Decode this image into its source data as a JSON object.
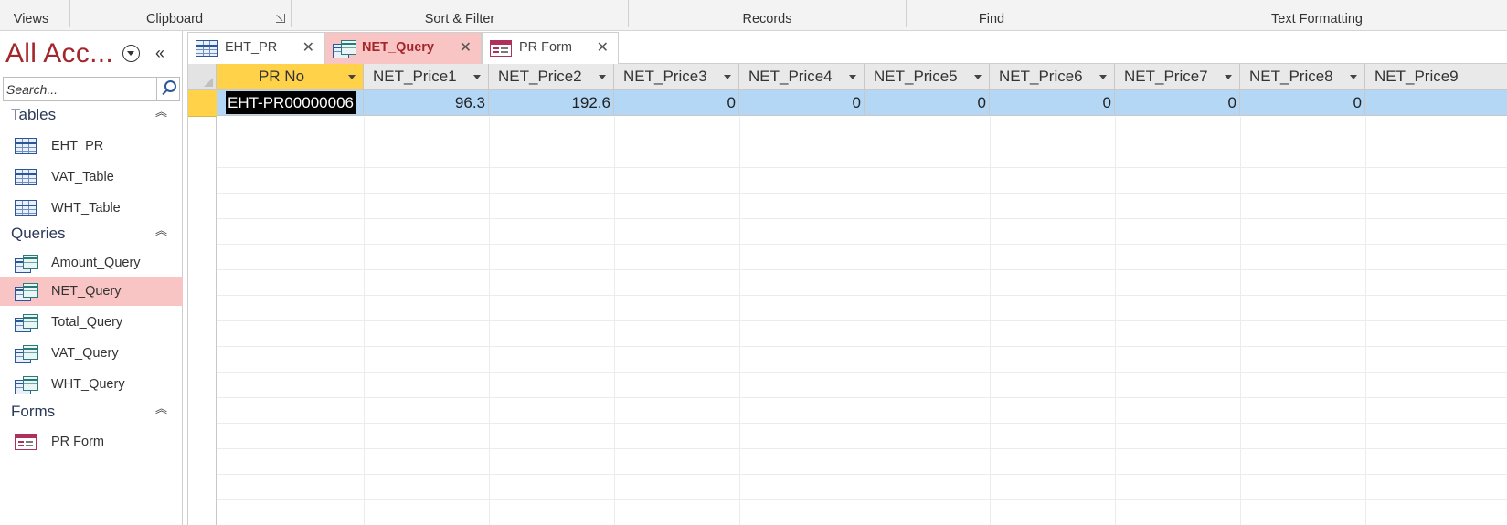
{
  "ribbon": {
    "groups": [
      "Views",
      "Clipboard",
      "Sort & Filter",
      "Records",
      "Find",
      "Text Formatting"
    ]
  },
  "nav": {
    "title": "All Acc...",
    "search": {
      "placeholder": "Search..."
    },
    "sections": [
      {
        "label": "Tables",
        "items": [
          "EHT_PR",
          "VAT_Table",
          "WHT_Table"
        ]
      },
      {
        "label": "Queries",
        "items": [
          "Amount_Query",
          "NET_Query",
          "Total_Query",
          "VAT_Query",
          "WHT_Query"
        ]
      },
      {
        "label": "Forms",
        "items": [
          "PR Form"
        ]
      }
    ],
    "selected": "NET_Query"
  },
  "tabs": [
    {
      "label": "EHT_PR",
      "icon": "table-icon",
      "close": "✕"
    },
    {
      "label": "NET_Query",
      "icon": "query-icon",
      "close": "✕"
    },
    {
      "label": "PR Form",
      "icon": "form-icon",
      "close": "✕"
    }
  ],
  "datasheet": {
    "columns": [
      "PR No",
      "NET_Price1",
      "NET_Price2",
      "NET_Price3",
      "NET_Price4",
      "NET_Price5",
      "NET_Price6",
      "NET_Price7",
      "NET_Price8",
      "NET_Price9"
    ],
    "rows": [
      [
        "EHT-PR00000006",
        "96.3",
        "192.6",
        "0",
        "0",
        "0",
        "0",
        "0",
        "0",
        ""
      ]
    ]
  },
  "colors": {
    "accent": "#a4262c",
    "selected_tab": "#f9c4c4",
    "row_highlight": "#b3d7f5",
    "header_active": "#ffd24a"
  }
}
